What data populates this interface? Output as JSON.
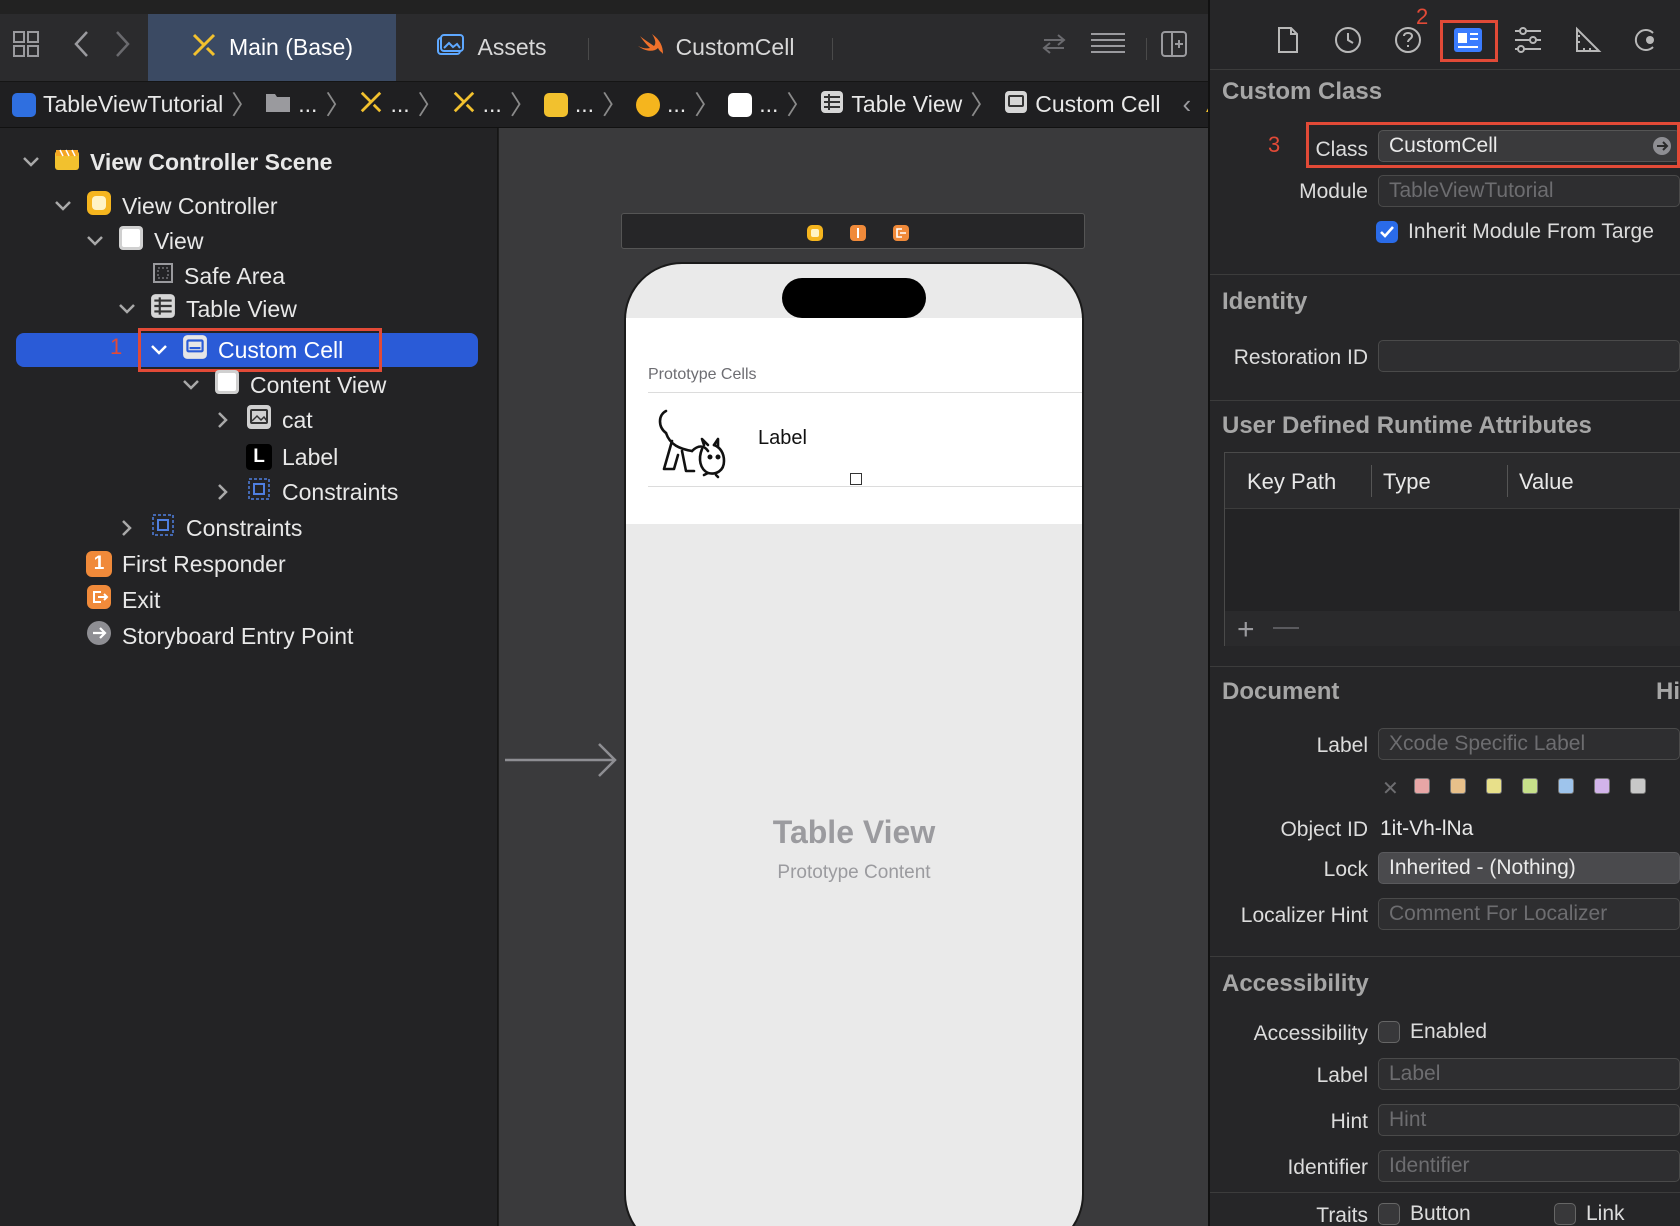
{
  "tabs": [
    {
      "label": "Main (Base)",
      "active": true
    },
    {
      "label": "Assets",
      "active": false
    },
    {
      "label": "CustomCell",
      "active": false
    }
  ],
  "breadcrumb": {
    "project": "TableViewTutorial",
    "ellipsis": "...",
    "table_view": "Table View",
    "custom_cell": "Custom Cell"
  },
  "outline": {
    "scene": "View Controller Scene",
    "view_controller": "View Controller",
    "view": "View",
    "safe_area": "Safe Area",
    "table_view": "Table View",
    "custom_cell": "Custom Cell",
    "content_view": "Content View",
    "cat": "cat",
    "label": "Label",
    "constraints_inner": "Constraints",
    "constraints_outer": "Constraints",
    "first_responder": "First Responder",
    "exit": "Exit",
    "entry_point": "Storyboard Entry Point",
    "label_glyph": "L",
    "first_responder_glyph": "1"
  },
  "annotations": {
    "step1": "1",
    "step2": "2",
    "step3": "3"
  },
  "canvas": {
    "prototype_cells": "Prototype Cells",
    "cell_label": "Label",
    "table_view_title": "Table View",
    "prototype_content": "Prototype Content"
  },
  "inspector": {
    "custom_class": {
      "title": "Custom Class",
      "class_label": "Class",
      "class_value": "CustomCell",
      "module_label": "Module",
      "module_placeholder": "TableViewTutorial",
      "inherit_label": "Inherit Module From Targe",
      "inherit_checked": true
    },
    "identity": {
      "title": "Identity",
      "restoration_label": "Restoration ID",
      "restoration_value": ""
    },
    "runtime_attrs": {
      "title": "User Defined Runtime Attributes",
      "columns": [
        "Key Path",
        "Type",
        "Value"
      ],
      "rows": []
    },
    "document": {
      "title": "Document",
      "hi_text": "Hi",
      "label_label": "Label",
      "label_placeholder": "Xcode Specific Label",
      "colors": [
        "#e8a6a6",
        "#e8c08a",
        "#e8e08a",
        "#c6e08a",
        "#9ec4ec",
        "#d2b4ea",
        "#c8c8c8"
      ],
      "object_id_label": "Object ID",
      "object_id": "1it-Vh-lNa",
      "lock_label": "Lock",
      "lock_value": "Inherited - (Nothing)",
      "localizer_label": "Localizer Hint",
      "localizer_placeholder": "Comment For Localizer"
    },
    "accessibility": {
      "title": "Accessibility",
      "acc_label": "Accessibility",
      "enabled_label": "Enabled",
      "label_label": "Label",
      "label_placeholder": "Label",
      "hint_label": "Hint",
      "hint_placeholder": "Hint",
      "identifier_label": "Identifier",
      "identifier_placeholder": "Identifier",
      "traits_label": "Traits",
      "button_trait": "Button",
      "link_trait": "Link"
    }
  },
  "colors": {
    "accent": "#2a5bd7",
    "annotation": "#e24a37"
  }
}
